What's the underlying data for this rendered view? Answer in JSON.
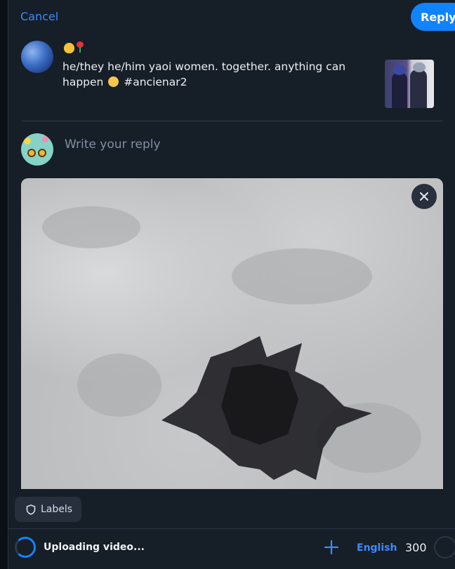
{
  "header": {
    "cancel_label": "Cancel",
    "reply_label": "Reply"
  },
  "parent_post": {
    "display_name_emojis": [
      "onion-emoji",
      "rose-emoji"
    ],
    "text_before_emoji": "he/they he/him yaoi women. together. anything can happen",
    "face_emoji": "pleading-face-emoji",
    "hashtag": "#ancienar2"
  },
  "composer": {
    "placeholder": "Write your reply"
  },
  "footer": {
    "labels_label": "Labels",
    "upload_status": "Uploading video...",
    "language": "English",
    "char_remaining": "300"
  },
  "colors": {
    "accent": "#1083fe",
    "link": "#3c8bff",
    "background": "#161e27"
  }
}
